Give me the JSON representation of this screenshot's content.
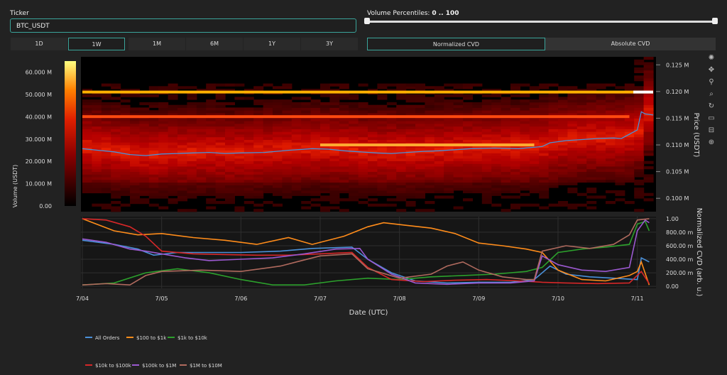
{
  "controls": {
    "ticker_label": "Ticker",
    "ticker_value": "BTC_USDT",
    "percentile_label": "Volume Percentiles:",
    "percentile_value": "0 .. 100",
    "timeframes": [
      "1D",
      "1W",
      "1M",
      "6M",
      "1Y",
      "3Y"
    ],
    "active_timeframe": "1W",
    "modes": [
      "Normalized CVD",
      "Absolute CVD"
    ],
    "active_mode": "Normalized CVD"
  },
  "modebar_icons": [
    "plotly-logo-icon",
    "pan-icon",
    "zoom-icon",
    "lasso-icon",
    "reset-icon",
    "save-icon",
    "compare-icon",
    "spike-icon"
  ],
  "chart_data": [
    {
      "type": "heatmap",
      "title": "",
      "xlabel": "",
      "ylabel": "Price (USDT)",
      "colorbar_title": "Volume (USDT)",
      "colorbar_ticks": [
        "0.00",
        "10.000 M",
        "20.000 M",
        "30.000 M",
        "40.000 M",
        "50.000 M",
        "60.000 M"
      ],
      "colorbar_range": [
        0,
        65
      ],
      "y_ticks": [
        "0.100 M",
        "0.105 M",
        "0.110 M",
        "0.115 M",
        "0.120 M",
        "0.125 M"
      ],
      "y_tick_values": [
        100000,
        105000,
        110000,
        115000,
        120000,
        125000
      ],
      "ylim": [
        97500,
        126500
      ],
      "x_dates": [
        "7/04",
        "7/05",
        "7/06",
        "7/07",
        "7/08",
        "7/09",
        "7/10",
        "7/11"
      ],
      "price_line_color": "#4a90d9",
      "price_series": [
        [
          0,
          109300
        ],
        [
          0.2,
          109000
        ],
        [
          0.4,
          108700
        ],
        [
          0.6,
          108200
        ],
        [
          0.8,
          108000
        ],
        [
          1.0,
          108300
        ],
        [
          1.2,
          108400
        ],
        [
          1.4,
          108500
        ],
        [
          1.6,
          108600
        ],
        [
          1.8,
          108400
        ],
        [
          2.0,
          108500
        ],
        [
          2.3,
          108600
        ],
        [
          2.6,
          109000
        ],
        [
          2.9,
          109300
        ],
        [
          3.1,
          109200
        ],
        [
          3.3,
          108900
        ],
        [
          3.5,
          108700
        ],
        [
          3.7,
          108500
        ],
        [
          3.9,
          108400
        ],
        [
          4.1,
          108600
        ],
        [
          4.3,
          108800
        ],
        [
          4.5,
          108900
        ],
        [
          4.7,
          109100
        ],
        [
          4.9,
          109300
        ],
        [
          5.2,
          109400
        ],
        [
          5.5,
          109300
        ],
        [
          5.8,
          109700
        ],
        [
          5.9,
          110400
        ],
        [
          6.1,
          110800
        ],
        [
          6.3,
          111000
        ],
        [
          6.5,
          111200
        ],
        [
          6.7,
          111300
        ],
        [
          6.8,
          111200
        ],
        [
          6.9,
          112000
        ],
        [
          7.0,
          112800
        ],
        [
          7.05,
          116200
        ],
        [
          7.1,
          115800
        ],
        [
          7.2,
          115600
        ]
      ],
      "bright_bands": [
        {
          "price": 119900,
          "from": 0,
          "to": 7.2,
          "color": "#ffb000"
        },
        {
          "price": 115300,
          "from": 0,
          "to": 6.9,
          "color": "#ff4a10"
        },
        {
          "price": 110000,
          "from": 3.0,
          "to": 5.7,
          "color": "#ffaa30"
        }
      ]
    },
    {
      "type": "line",
      "title": "",
      "xlabel": "Date (UTC)",
      "ylabel": "Normalized CVD (arb. u.)",
      "x_ticks": [
        "7/04",
        "7/05",
        "7/06",
        "7/07",
        "7/08",
        "7/09",
        "7/10",
        "7/11"
      ],
      "y_ticks": [
        "0.00",
        "200.00 m",
        "400.00 m",
        "600.00 m",
        "800.00 m",
        "1.00"
      ],
      "y_tick_values": [
        0,
        0.2,
        0.4,
        0.6,
        0.8,
        1.0
      ],
      "ylim": [
        -0.03,
        1.03
      ],
      "legend_position": "bottom",
      "series": [
        {
          "name": "All Orders",
          "color": "#4a90d9",
          "points": [
            [
              0,
              0.68
            ],
            [
              0.4,
              0.62
            ],
            [
              0.7,
              0.55
            ],
            [
              0.9,
              0.46
            ],
            [
              1.2,
              0.5
            ],
            [
              1.6,
              0.5
            ],
            [
              2.0,
              0.5
            ],
            [
              2.5,
              0.52
            ],
            [
              2.9,
              0.56
            ],
            [
              3.4,
              0.58
            ],
            [
              3.6,
              0.4
            ],
            [
              3.9,
              0.2
            ],
            [
              4.2,
              0.08
            ],
            [
              4.6,
              0.05
            ],
            [
              5.0,
              0.06
            ],
            [
              5.4,
              0.06
            ],
            [
              5.7,
              0.1
            ],
            [
              5.9,
              0.3
            ],
            [
              6.1,
              0.18
            ],
            [
              6.4,
              0.14
            ],
            [
              6.7,
              0.12
            ],
            [
              7.0,
              0.1
            ],
            [
              7.05,
              0.42
            ],
            [
              7.15,
              0.36
            ]
          ]
        },
        {
          "name": "$100 to $1k",
          "color": "#ff8c1a",
          "points": [
            [
              0,
              1.0
            ],
            [
              0.4,
              0.82
            ],
            [
              0.7,
              0.76
            ],
            [
              1.0,
              0.78
            ],
            [
              1.4,
              0.72
            ],
            [
              1.8,
              0.68
            ],
            [
              2.2,
              0.62
            ],
            [
              2.6,
              0.72
            ],
            [
              2.9,
              0.62
            ],
            [
              3.3,
              0.74
            ],
            [
              3.6,
              0.88
            ],
            [
              3.8,
              0.94
            ],
            [
              4.1,
              0.9
            ],
            [
              4.4,
              0.86
            ],
            [
              4.7,
              0.78
            ],
            [
              5.0,
              0.64
            ],
            [
              5.3,
              0.6
            ],
            [
              5.6,
              0.55
            ],
            [
              5.8,
              0.5
            ],
            [
              6.0,
              0.24
            ],
            [
              6.3,
              0.1
            ],
            [
              6.6,
              0.08
            ],
            [
              6.9,
              0.16
            ],
            [
              7.0,
              0.22
            ],
            [
              7.05,
              0.36
            ],
            [
              7.15,
              0.02
            ]
          ]
        },
        {
          "name": "$1k to $10k",
          "color": "#2ca02c",
          "points": [
            [
              0,
              0.02
            ],
            [
              0.4,
              0.05
            ],
            [
              0.8,
              0.2
            ],
            [
              1.2,
              0.26
            ],
            [
              1.6,
              0.2
            ],
            [
              2.0,
              0.1
            ],
            [
              2.4,
              0.02
            ],
            [
              2.8,
              0.02
            ],
            [
              3.2,
              0.08
            ],
            [
              3.6,
              0.12
            ],
            [
              4.0,
              0.1
            ],
            [
              4.4,
              0.14
            ],
            [
              4.8,
              0.16
            ],
            [
              5.2,
              0.18
            ],
            [
              5.6,
              0.22
            ],
            [
              5.8,
              0.28
            ],
            [
              6.0,
              0.5
            ],
            [
              6.3,
              0.55
            ],
            [
              6.6,
              0.58
            ],
            [
              6.9,
              0.62
            ],
            [
              7.0,
              0.92
            ],
            [
              7.1,
              0.96
            ],
            [
              7.15,
              0.82
            ]
          ]
        },
        {
          "name": "$10k to $100k",
          "color": "#d62728",
          "points": [
            [
              0,
              1.0
            ],
            [
              0.3,
              0.98
            ],
            [
              0.6,
              0.88
            ],
            [
              0.8,
              0.74
            ],
            [
              1.0,
              0.52
            ],
            [
              1.4,
              0.48
            ],
            [
              1.8,
              0.47
            ],
            [
              2.2,
              0.46
            ],
            [
              2.6,
              0.46
            ],
            [
              3.0,
              0.48
            ],
            [
              3.4,
              0.5
            ],
            [
              3.6,
              0.28
            ],
            [
              3.9,
              0.1
            ],
            [
              4.3,
              0.07
            ],
            [
              4.7,
              0.09
            ],
            [
              5.1,
              0.1
            ],
            [
              5.5,
              0.08
            ],
            [
              5.8,
              0.06
            ],
            [
              6.1,
              0.05
            ],
            [
              6.5,
              0.04
            ],
            [
              6.9,
              0.05
            ],
            [
              7.05,
              0.22
            ],
            [
              7.15,
              0.04
            ]
          ]
        },
        {
          "name": "$100k to $1M",
          "color": "#9b59d0",
          "points": [
            [
              0,
              0.7
            ],
            [
              0.3,
              0.65
            ],
            [
              0.6,
              0.55
            ],
            [
              0.8,
              0.52
            ],
            [
              1.0,
              0.48
            ],
            [
              1.3,
              0.42
            ],
            [
              1.6,
              0.38
            ],
            [
              2.0,
              0.4
            ],
            [
              2.4,
              0.42
            ],
            [
              2.8,
              0.48
            ],
            [
              3.2,
              0.55
            ],
            [
              3.5,
              0.56
            ],
            [
              3.6,
              0.4
            ],
            [
              3.9,
              0.18
            ],
            [
              4.2,
              0.05
            ],
            [
              4.6,
              0.03
            ],
            [
              5.0,
              0.05
            ],
            [
              5.4,
              0.05
            ],
            [
              5.7,
              0.08
            ],
            [
              5.8,
              0.45
            ],
            [
              6.0,
              0.32
            ],
            [
              6.3,
              0.24
            ],
            [
              6.6,
              0.22
            ],
            [
              6.9,
              0.28
            ],
            [
              7.0,
              0.82
            ],
            [
              7.1,
              0.98
            ],
            [
              7.15,
              0.94
            ]
          ]
        },
        {
          "name": "$1M to $10M",
          "color": "#b06a5e",
          "points": [
            [
              0,
              0.02
            ],
            [
              0.3,
              0.04
            ],
            [
              0.6,
              0.02
            ],
            [
              0.8,
              0.16
            ],
            [
              1.0,
              0.22
            ],
            [
              1.5,
              0.24
            ],
            [
              2.0,
              0.22
            ],
            [
              2.5,
              0.3
            ],
            [
              2.7,
              0.36
            ],
            [
              3.0,
              0.45
            ],
            [
              3.4,
              0.48
            ],
            [
              3.6,
              0.26
            ],
            [
              4.0,
              0.12
            ],
            [
              4.4,
              0.18
            ],
            [
              4.6,
              0.3
            ],
            [
              4.8,
              0.36
            ],
            [
              5.0,
              0.24
            ],
            [
              5.3,
              0.14
            ],
            [
              5.6,
              0.1
            ],
            [
              5.7,
              0.1
            ],
            [
              5.8,
              0.52
            ],
            [
              6.1,
              0.6
            ],
            [
              6.4,
              0.56
            ],
            [
              6.7,
              0.62
            ],
            [
              6.9,
              0.76
            ],
            [
              7.0,
              0.98
            ],
            [
              7.15,
              1.0
            ]
          ]
        }
      ]
    }
  ]
}
